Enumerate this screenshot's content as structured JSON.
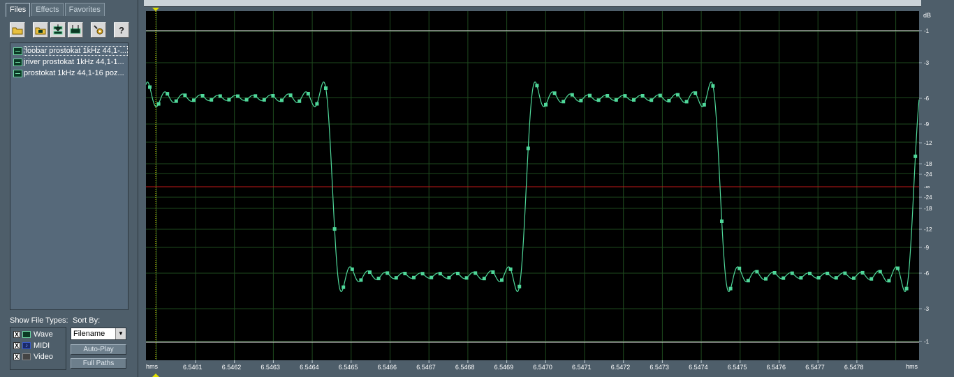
{
  "tabs": {
    "files": "Files",
    "effects": "Effects",
    "favorites": "Favorites"
  },
  "toolbar": {
    "icons": [
      "open-folder-icon",
      "open-file-icon",
      "insert-icon",
      "mix-icon",
      "settings-icon",
      "help-icon"
    ],
    "help_label": "?"
  },
  "files": [
    {
      "name": "foobar prostokat 1kHz 44,1-..."
    },
    {
      "name": "jriver prostokat 1kHz 44,1-1..."
    },
    {
      "name": "prostokat 1kHz 44,1-16 poz..."
    }
  ],
  "show_file_types": {
    "label": "Show File Types:",
    "items": [
      {
        "label": "Wave",
        "checked": "X"
      },
      {
        "label": "MIDI",
        "checked": "X"
      },
      {
        "label": "Video",
        "checked": "X"
      }
    ]
  },
  "sort_by": {
    "label": "Sort By:",
    "value": "Filename"
  },
  "buttons": {
    "auto_play": "Auto-Play",
    "full_paths": "Full Paths"
  },
  "waveform": {
    "time_labels": [
      "6.5461",
      "6.5462",
      "6.5463",
      "6.5464",
      "6.5465",
      "6.5466",
      "6.5467",
      "6.5468",
      "6.5469",
      "6.5470",
      "6.5471",
      "6.5472",
      "6.5473",
      "6.5474",
      "6.5475",
      "6.5476",
      "6.5477",
      "6.5478"
    ],
    "time_unit_left": "hms",
    "time_unit_right": "hms",
    "db_header": "dB",
    "db_labels_top": [
      "-1",
      "-3",
      "-6",
      "-9",
      "-12",
      "-18",
      "-24"
    ],
    "db_center": "-∞",
    "db_labels_bottom": [
      "-24",
      "-18",
      "-12",
      "-9",
      "-6",
      "-3",
      "-1"
    ],
    "colors": {
      "background": "#000000",
      "grid": "#1e4a1e",
      "wave": "#4fd89a",
      "center_line": "#c01818",
      "clip_line": "#e8e8e8",
      "axis_text": "#ffffff",
      "cursor": "#e0e000"
    }
  }
}
